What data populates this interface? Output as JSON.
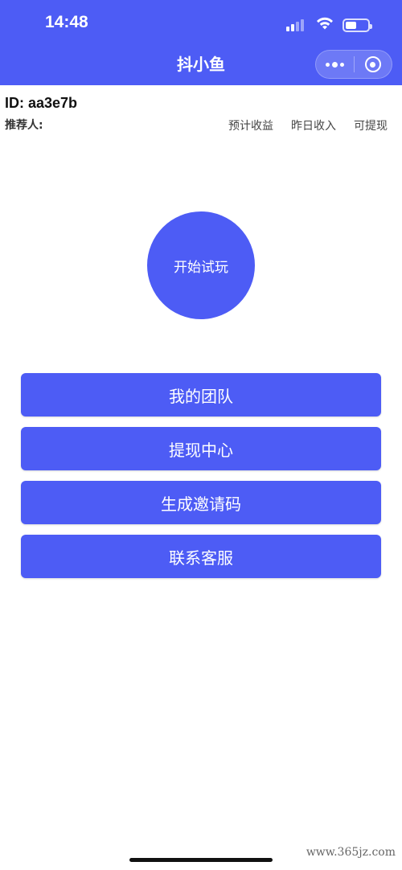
{
  "status_bar": {
    "time": "14:48",
    "battery_level": 0.5
  },
  "nav": {
    "title": "抖小鱼"
  },
  "user": {
    "id_text": "ID: aa3e7b",
    "referrer_label": "推荐人:"
  },
  "stats": {
    "items": [
      "预计收益",
      "昨日收入",
      "可提现"
    ]
  },
  "start_button": {
    "label": "开始试玩"
  },
  "actions": [
    {
      "label": "我的团队"
    },
    {
      "label": "提现中心"
    },
    {
      "label": "生成邀请码"
    },
    {
      "label": "联系客服"
    }
  ],
  "watermark": "www.365jz.com",
  "colors": {
    "primary": "#4D5CF5",
    "background": "#ffffff",
    "text_dark": "#111111"
  },
  "icons": [
    "signal-icon",
    "wifi-icon",
    "battery-icon",
    "more-icon",
    "close-target-icon"
  ]
}
